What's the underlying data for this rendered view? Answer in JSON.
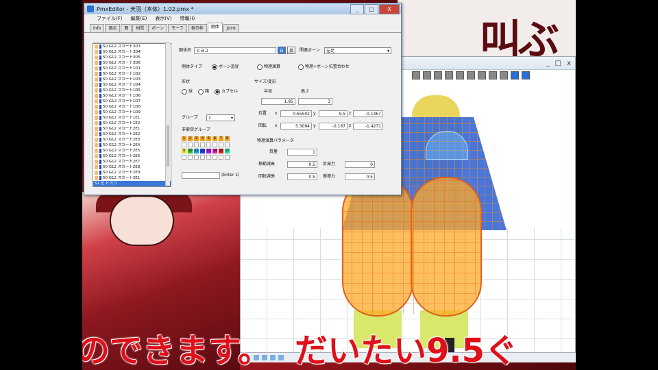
{
  "window": {
    "title": "PmxEditor - 天羽（本体）1.02.pmx *",
    "buttons": {
      "minimize": "_",
      "maximize": "□",
      "close": "X"
    }
  },
  "menu": [
    "ファイル(F)",
    "編集(E)",
    "表示(V)",
    "情報(I)"
  ],
  "tabs": [
    "Info",
    "頂点",
    "面",
    "材質",
    "ボーン",
    "モーフ",
    "表示枠",
    "剛体",
    "Joint"
  ],
  "active_tab": "剛体",
  "rigid_body": {
    "name_label": "剛体名",
    "name_value": "ヒヨコ",
    "name_btn_jp": "日",
    "name_btn_en": "英",
    "bone_label": "関連ボーン",
    "bone_value": "左足",
    "type_label": "剛体タイプ",
    "type_options": [
      "ボーン追従",
      "物理演算",
      "物理+ボーン位置合わせ"
    ],
    "shape_label": "形状",
    "shape_options": [
      "球",
      "箱",
      "カプセル"
    ],
    "size_label": "サイズ/変形",
    "radius_label": "半径",
    "height_label": "高さ",
    "radius_value": "1.85",
    "height_value": "3",
    "position_label": "位置",
    "pos_x": "0.65502",
    "pos_y": "9.5",
    "pos_z": "-0.1467",
    "rotation_label": "回転",
    "rot_x": "5.3094",
    "rot_y": "-0.167",
    "rot_z": "-1.4271",
    "group_label": "グループ",
    "group_value": "1",
    "nocollide_label": "非衝突グループ",
    "group_numbers": [
      "1",
      "2",
      "3",
      "4",
      "5",
      "6",
      "7",
      "8"
    ],
    "group_numbers2": [
      "9",
      "10",
      "11",
      "12",
      "13",
      "14",
      "15",
      "16"
    ],
    "enter_hint": "(Enter 1)",
    "physics_label": "物理演算パラメータ",
    "mass_label": "質量",
    "mass_value": "1",
    "lin_damp_label": "移動減衰",
    "lin_damp_value": "0.5",
    "ang_damp_label": "回転減衰",
    "ang_damp_value": "0.5",
    "restitution_label": "反発力",
    "restitution_value": "0",
    "friction_label": "摩擦力",
    "friction_value": "0.5"
  },
  "list_rows": [
    "50 G12 スカート3D3",
    "50 G12 スカート3D4",
    "50 G12 スカート3D5",
    "50 G12 スカート3D6",
    "50 G12 スカート1D1",
    "50 G12 スカート1D2",
    "50 G12 スカート1D3",
    "50 G12 スカート1D4",
    "50 G12 スカート1D5",
    "50 G12 スカート1D6",
    "50 G12 スカート1D7",
    "50 G12 スカート1D8",
    "50 G12 スカート1D9",
    "50 G12 スカート1E1",
    "50 G12 スカート1E2",
    "50 G12 スカート2E1",
    "50 G12 スカート2E2",
    "50 G12 スカート2E3",
    "50 G12 スカート2E4",
    "50 G12 スカート2E5",
    "50 G12 スカート2E6",
    "50 G12 スカート2E7",
    "50 G12 スカート2E8",
    "50 G12 スカート2E9",
    "50 G12 スカート3E1"
  ],
  "list_selected": "51 左 ヒヨコ",
  "background": {
    "kanji": "叫ぶ"
  },
  "subtitles": {
    "left": "のできます。",
    "right": "だいたい9.5ぐ"
  },
  "colors": {
    "accent": "#3a78d8",
    "subtitle": "#e0101a"
  }
}
